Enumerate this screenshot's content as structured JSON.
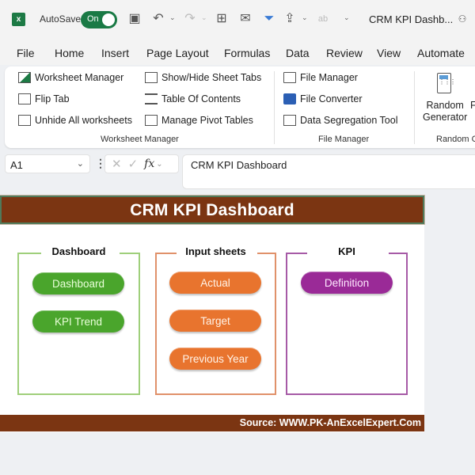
{
  "titlebar": {
    "app_icon": "excel-icon",
    "autosave_label": "AutoSave",
    "autosave_state": "On",
    "doc_title": "CRM KPI Dashb...",
    "icons": [
      "save-icon",
      "undo-icon",
      "redo-icon",
      "borders-icon",
      "mail-icon",
      "filter-icon",
      "share-icon",
      "spelling-icon",
      "customize-qat-icon",
      "coauthor-icon"
    ]
  },
  "menu": {
    "items": [
      "File",
      "Home",
      "Insert",
      "Page Layout",
      "Formulas",
      "Data",
      "Review",
      "View",
      "Automate"
    ]
  },
  "ribbon": {
    "worksheet_manager": {
      "label": "Worksheet Manager",
      "items": [
        "Worksheet Manager",
        "Flip Tab",
        "Unhide All worksheets",
        "Show/Hide Sheet Tabs",
        "Table Of Contents",
        "Manage Pivot Tables"
      ]
    },
    "file_manager": {
      "label": "File Manager",
      "items": [
        "File Manager",
        "File Converter",
        "Data Segregation Tool"
      ]
    },
    "random": {
      "label": "Random G",
      "button_line1": "Random",
      "button_line2": "Generator",
      "next_partial": "F"
    }
  },
  "formula_bar": {
    "name_box": "A1",
    "fx_label": "fx",
    "formula": "CRM KPI Dashboard"
  },
  "sheet": {
    "banner_title": "CRM KPI Dashboard",
    "footer": "Source: WWW.PK-AnExcelExpert.Com",
    "colors": {
      "banner": "#7b3512",
      "green": "#4aa52c",
      "orange": "#e8742e",
      "purple": "#9a2a97"
    },
    "panels": [
      {
        "title": "Dashboard",
        "buttons": [
          "Dashboard",
          "KPI Trend"
        ]
      },
      {
        "title": "Input sheets",
        "buttons": [
          "Actual",
          "Target",
          "Previous Year"
        ]
      },
      {
        "title": "KPI",
        "buttons": [
          "Definition"
        ]
      }
    ]
  }
}
